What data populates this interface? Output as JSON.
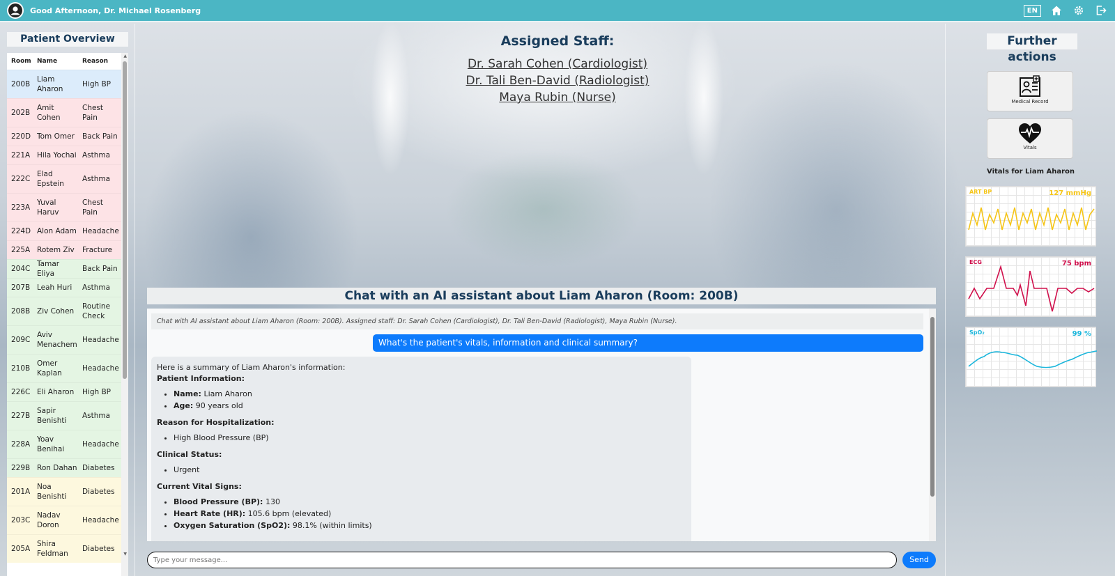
{
  "header": {
    "greeting": "Good Afternoon, Dr. Michael Rosenberg",
    "language": "EN"
  },
  "patient_overview": {
    "title": "Patient Overview",
    "columns": [
      "Room",
      "Name",
      "Reason"
    ],
    "rows": [
      {
        "room": "200B",
        "name": "Liam Aharon",
        "reason": "High BP",
        "color": "#dcecfb"
      },
      {
        "room": "202B",
        "name": "Amit Cohen",
        "reason": "Chest Pain",
        "color": "#fde3e6"
      },
      {
        "room": "220D",
        "name": "Tom Omer",
        "reason": "Back Pain",
        "color": "#fde3e6"
      },
      {
        "room": "221A",
        "name": "Hila Yochai",
        "reason": "Asthma",
        "color": "#fde3e6"
      },
      {
        "room": "222C",
        "name": "Elad Epstein",
        "reason": "Asthma",
        "color": "#fde3e6"
      },
      {
        "room": "223A",
        "name": "Yuval Haruv",
        "reason": "Chest Pain",
        "color": "#fde3e6"
      },
      {
        "room": "224D",
        "name": "Alon Adam",
        "reason": "Headache",
        "color": "#fde3e6"
      },
      {
        "room": "225A",
        "name": "Rotem Ziv",
        "reason": "Fracture",
        "color": "#fde3e6"
      },
      {
        "room": "204C",
        "name": "Tamar Eliya",
        "reason": "Back Pain",
        "color": "#e4f5e3"
      },
      {
        "room": "207B",
        "name": "Leah Huri",
        "reason": "Asthma",
        "color": "#e4f5e3"
      },
      {
        "room": "208B",
        "name": "Ziv Cohen",
        "reason": "Routine Check",
        "color": "#e4f5e3"
      },
      {
        "room": "209C",
        "name": "Aviv Menachem",
        "reason": "Headache",
        "color": "#e4f5e3"
      },
      {
        "room": "210B",
        "name": "Omer Kaplan",
        "reason": "Headache",
        "color": "#e4f5e3"
      },
      {
        "room": "226C",
        "name": "Eli Aharon",
        "reason": "High BP",
        "color": "#e4f5e3"
      },
      {
        "room": "227B",
        "name": "Sapir Benishti",
        "reason": "Asthma",
        "color": "#e4f5e3"
      },
      {
        "room": "228A",
        "name": "Yoav Benihai",
        "reason": "Headache",
        "color": "#e4f5e3"
      },
      {
        "room": "229B",
        "name": "Ron Dahan",
        "reason": "Diabetes",
        "color": "#e4f5e3"
      },
      {
        "room": "201A",
        "name": "Noa Benishti",
        "reason": "Diabetes",
        "color": "#fdf8de"
      },
      {
        "room": "203C",
        "name": "Nadav Doron",
        "reason": "Headache",
        "color": "#fdf8de"
      },
      {
        "room": "205A",
        "name": "Shira Feldman",
        "reason": "Diabetes",
        "color": "#fdf8de"
      }
    ]
  },
  "staff": {
    "title": "Assigned Staff:",
    "members": [
      "Dr. Sarah Cohen (Cardiologist)",
      "Dr. Tali Ben-David (Radiologist)",
      "Maya Rubin (Nurse)"
    ]
  },
  "chat": {
    "title": "Chat with an AI assistant about Liam Aharon (Room: 200B)",
    "system_message": "Chat with AI assistant about Liam Aharon (Room: 200B). Assigned staff: Dr. Sarah Cohen (Cardiologist), Dr. Tali Ben-David (Radiologist), Maya Rubin (Nurse).",
    "user_message": "What's the patient's vitals, information and clinical summary?",
    "bot": {
      "intro": "Here is a summary of Liam Aharon's information:",
      "patient_info_heading": "Patient Information:",
      "name_label": "Name:",
      "name_value": " Liam Aharon",
      "age_label": "Age:",
      "age_value": " 90 years old",
      "reason_heading": "Reason for Hospitalization:",
      "reason_value": "High Blood Pressure (BP)",
      "status_heading": "Clinical Status:",
      "status_value": "Urgent",
      "vitals_heading": "Current Vital Signs:",
      "bp_label": "Blood Pressure (BP):",
      "bp_value": " 130",
      "hr_label": "Heart Rate (HR):",
      "hr_value": " 105.6 bpm (elevated)",
      "spo2_label": "Oxygen Saturation (SpO2):",
      "spo2_value": " 98.1% (within limits)"
    },
    "input_placeholder": "Type your message...",
    "send_label": "Send"
  },
  "further_actions": {
    "title": "Further actions",
    "medical_record_label": "Medical Record",
    "vitals_label": "Vitals",
    "vitals_for": "Vitals for Liam Aharon"
  },
  "vitals": {
    "art_bp": {
      "label": "ART BP",
      "value": "127 mmHg",
      "color": "#f5c518"
    },
    "ecg": {
      "label": "ECG",
      "value": "75 bpm",
      "color": "#d0104c"
    },
    "spo2": {
      "label": "SpO₂",
      "value": "99 %",
      "color": "#1ab6dc"
    }
  },
  "colors": {
    "header": "#4bb6c4",
    "accent": "#0d7bfc",
    "title_text": "#1a3d5c"
  }
}
